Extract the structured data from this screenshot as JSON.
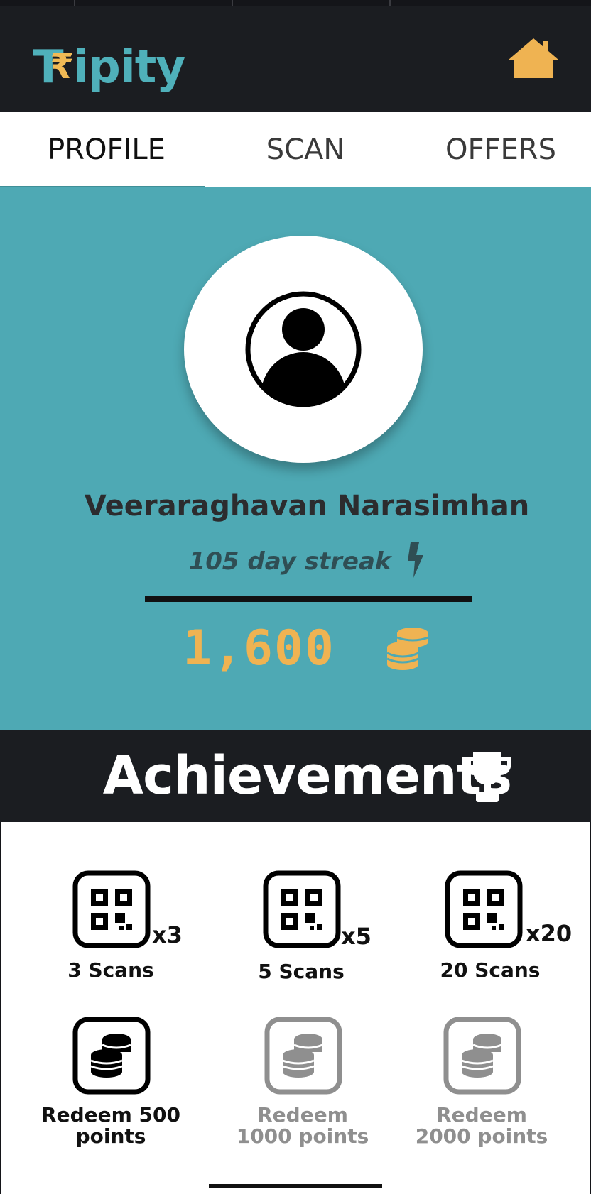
{
  "app": {
    "logo_prefix": "T",
    "logo_rupee": "₹",
    "logo_suffix": "ipity",
    "home_icon": "home-icon"
  },
  "tabs": [
    {
      "label": "PROFILE",
      "active": true
    },
    {
      "label": "SCAN",
      "active": false
    },
    {
      "label": "OFFERS",
      "active": false
    }
  ],
  "profile": {
    "name": "Veeraraghavan Narasimhan",
    "streak": "105 day streak",
    "points": "1,600"
  },
  "achievements": {
    "title": "Achievements",
    "badges": [
      {
        "multiplier": "x3",
        "label": "3 Scans",
        "icon": "qr-code-icon",
        "unlocked": true
      },
      {
        "multiplier": "x5",
        "label": "5 Scans",
        "icon": "qr-code-icon",
        "unlocked": true
      },
      {
        "multiplier": "x20",
        "label": "20 Scans",
        "icon": "qr-code-icon",
        "unlocked": true
      },
      {
        "label_line1": "Redeem 500",
        "label_line2": "points",
        "icon": "coins-icon",
        "unlocked": true
      },
      {
        "label_line1": "Redeem",
        "label_line2": "1000 points",
        "icon": "coins-icon",
        "unlocked": false
      },
      {
        "label_line1": "Redeem",
        "label_line2": "2000 points",
        "icon": "coins-icon",
        "unlocked": false
      }
    ]
  },
  "colors": {
    "accent": "#4ea9b4",
    "header_bg": "#1b1d21",
    "gold": "#efb352",
    "locked": "#8f8f8f"
  }
}
